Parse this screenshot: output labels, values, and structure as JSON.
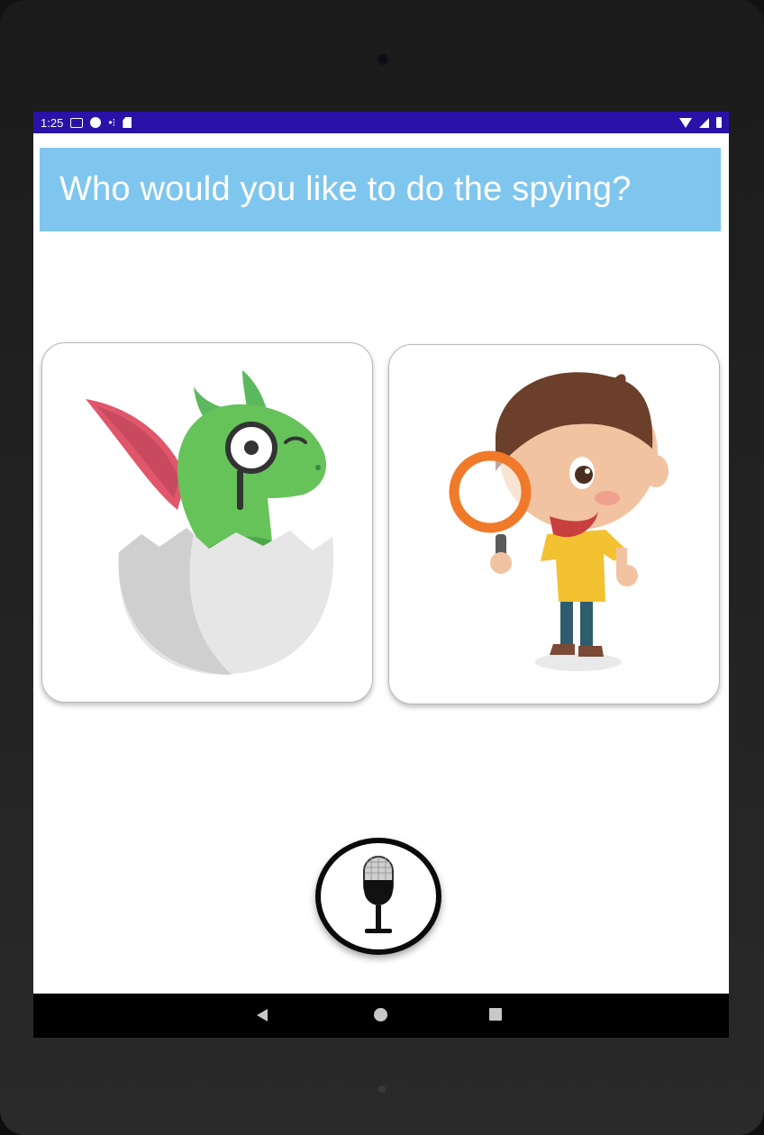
{
  "status_bar": {
    "time": "1:25",
    "left_icons": [
      "gmail-icon",
      "app-notification-icon",
      "network-icon",
      "sd-card-icon"
    ],
    "right_icons": [
      "wifi-icon",
      "cell-signal-icon",
      "battery-icon"
    ],
    "color": "#2a12a8"
  },
  "question": {
    "text": "Who would you like to do the spying?",
    "background": "#7fc6ef"
  },
  "choices": [
    {
      "id": "dragon",
      "illustration": "dragon-hatching-with-monocle"
    },
    {
      "id": "boy",
      "illustration": "boy-with-magnifying-glass"
    }
  ],
  "mic_button": {
    "icon": "microphone-icon"
  },
  "navigation_bar": {
    "buttons": [
      "back",
      "home",
      "recents"
    ]
  }
}
